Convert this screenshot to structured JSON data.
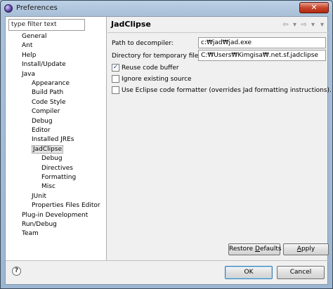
{
  "window": {
    "title": "Preferences",
    "close_glyph": "✕"
  },
  "left": {
    "filter_value": "type filter text",
    "tree": [
      {
        "label": "General",
        "indent": 0
      },
      {
        "label": "Ant",
        "indent": 0
      },
      {
        "label": "Help",
        "indent": 0
      },
      {
        "label": "Install/Update",
        "indent": 0
      },
      {
        "label": "Java",
        "indent": 0
      },
      {
        "label": "Appearance",
        "indent": 1
      },
      {
        "label": "Build Path",
        "indent": 1
      },
      {
        "label": "Code Style",
        "indent": 1
      },
      {
        "label": "Compiler",
        "indent": 1
      },
      {
        "label": "Debug",
        "indent": 1
      },
      {
        "label": "Editor",
        "indent": 1
      },
      {
        "label": "Installed JREs",
        "indent": 1
      },
      {
        "label": "JadClipse",
        "indent": 1,
        "selected": true
      },
      {
        "label": "Debug",
        "indent": 2
      },
      {
        "label": "Directives",
        "indent": 2
      },
      {
        "label": "Formatting",
        "indent": 2
      },
      {
        "label": "Misc",
        "indent": 2
      },
      {
        "label": "JUnit",
        "indent": 1
      },
      {
        "label": "Properties Files Editor",
        "indent": 1
      },
      {
        "label": "Plug-in Development",
        "indent": 0
      },
      {
        "label": "Run/Debug",
        "indent": 0
      },
      {
        "label": "Team",
        "indent": 0
      }
    ]
  },
  "page": {
    "title": "JadClipse",
    "nav": {
      "back": "⇦",
      "back_menu": "▾",
      "forward": "⇨",
      "forward_menu": "▾",
      "menu": "▾"
    },
    "decompiler_label": "Path to decompiler:",
    "decompiler_value": "c:₩jad₩jad.exe",
    "tempdir_label": "Directory for temporary files:",
    "tempdir_value": "C:₩Users₩Kimgisa₩.net.sf.jadclipse",
    "reuse_label": "Reuse code buffer",
    "reuse_checked": true,
    "ignore_label": "Ignore existing source",
    "ignore_checked": false,
    "eclipse_fmt_label": "Use Eclipse code formatter (overrides Jad formatting instructions).",
    "eclipse_fmt_checked": false,
    "check_glyph": "✓",
    "restore_defaults_pre": "Restore ",
    "restore_defaults_mn": "D",
    "restore_defaults_post": "efaults",
    "apply_mn": "A",
    "apply_post": "pply"
  },
  "footer": {
    "help_glyph": "?",
    "ok": "OK",
    "cancel": "Cancel"
  }
}
